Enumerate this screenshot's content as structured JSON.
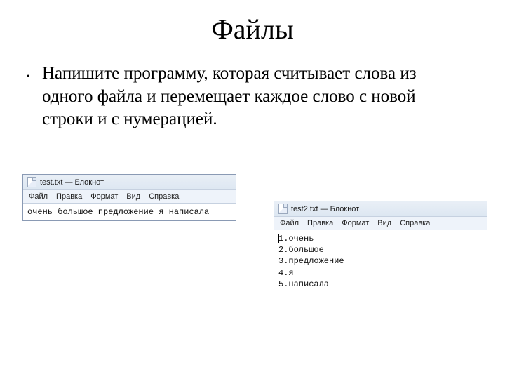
{
  "slide": {
    "title": "Файлы",
    "body": "Напишите программу, которая считывает слова из одного файла и перемещает каждое слово с новой строки и с нумерацией."
  },
  "notepad1": {
    "title": "test.txt — Блокнот",
    "menu": {
      "file": "Файл",
      "edit": "Правка",
      "format": "Формат",
      "view": "Вид",
      "help": "Справка"
    },
    "content": "очень большое предложение я написала"
  },
  "notepad2": {
    "title": "test2.txt — Блокнот",
    "menu": {
      "file": "Файл",
      "edit": "Правка",
      "format": "Формат",
      "view": "Вид",
      "help": "Справка"
    },
    "line1": "1.очень",
    "line2": "2.большое",
    "line3": "3.предложение",
    "line4": "4.я",
    "line5": "5.написала"
  }
}
